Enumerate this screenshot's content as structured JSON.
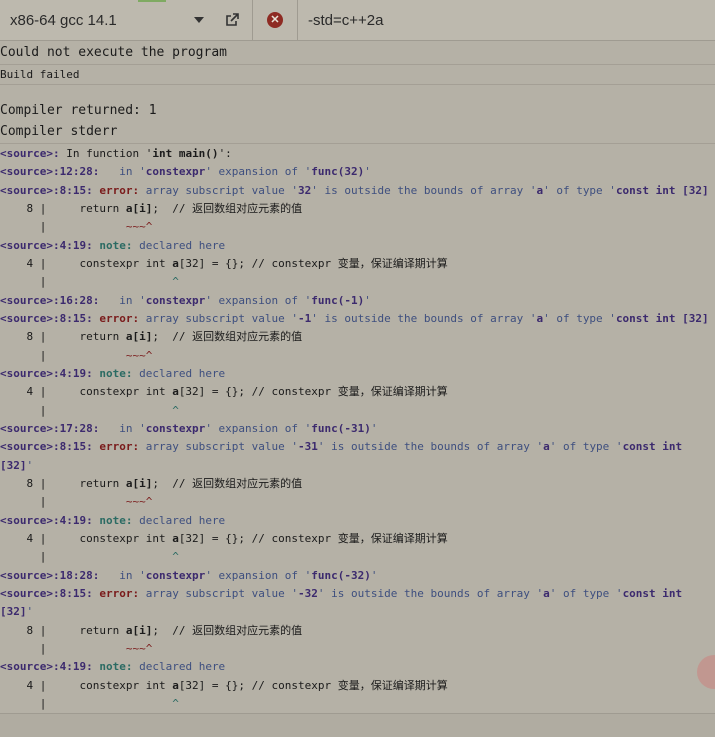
{
  "toolbar": {
    "compiler": "x86-64 gcc 14.1",
    "flags": "-std=c++2a",
    "close_glyph": "✕"
  },
  "output": {
    "status": "Could not execute the program",
    "build": "Build failed",
    "returned": "Compiler returned: 1",
    "stderr_title": "Compiler stderr"
  },
  "log": [
    [
      {
        "t": "<source>:",
        "c": "src"
      },
      {
        "t": " In function '"
      },
      {
        "t": "int main()",
        "c": "bold"
      },
      {
        "t": "':"
      }
    ],
    [
      {
        "t": "<source>:12:28:",
        "c": "src"
      },
      {
        "t": "   in '",
        "c": "blue"
      },
      {
        "t": "constexpr",
        "c": "src"
      },
      {
        "t": "' expansion of '",
        "c": "blue"
      },
      {
        "t": "func(32)",
        "c": "src"
      },
      {
        "t": "'",
        "c": "blue"
      }
    ],
    [
      {
        "t": "<source>:8:15:",
        "c": "src"
      },
      {
        "t": " error:",
        "c": "err"
      },
      {
        "t": " array subscript value '",
        "c": "blue"
      },
      {
        "t": "32",
        "c": "src"
      },
      {
        "t": "' is outside the bounds of array '",
        "c": "blue"
      },
      {
        "t": "a",
        "c": "src"
      },
      {
        "t": "' of type '",
        "c": "blue"
      },
      {
        "t": "const int [32]",
        "c": "src"
      }
    ],
    [
      {
        "t": "    8 |     return "
      },
      {
        "t": "a[i]",
        "c": "bold"
      },
      {
        "t": ";  // "
      },
      {
        "t": "返回数组对应元素的值",
        "c": "cn"
      }
    ],
    [
      {
        "t": "      |            "
      },
      {
        "t": "~~~^",
        "c": "caret-r"
      }
    ],
    [
      {
        "t": "<source>:4:19:",
        "c": "src"
      },
      {
        "t": " note:",
        "c": "note"
      },
      {
        "t": " declared here",
        "c": "blue"
      }
    ],
    [
      {
        "t": "    4 |     constexpr int "
      },
      {
        "t": "a",
        "c": "bold"
      },
      {
        "t": "[32] = {}; // constexpr "
      },
      {
        "t": "变量，保证编译期计算",
        "c": "cn"
      }
    ],
    [
      {
        "t": "      |                   "
      },
      {
        "t": "^",
        "c": "caret-g"
      }
    ],
    [
      {
        "t": "<source>:16:28:",
        "c": "src"
      },
      {
        "t": "   in '",
        "c": "blue"
      },
      {
        "t": "constexpr",
        "c": "src"
      },
      {
        "t": "' expansion of '",
        "c": "blue"
      },
      {
        "t": "func(-1)",
        "c": "src"
      },
      {
        "t": "'",
        "c": "blue"
      }
    ],
    [
      {
        "t": "<source>:8:15:",
        "c": "src"
      },
      {
        "t": " error:",
        "c": "err"
      },
      {
        "t": " array subscript value '",
        "c": "blue"
      },
      {
        "t": "-1",
        "c": "src"
      },
      {
        "t": "' is outside the bounds of array '",
        "c": "blue"
      },
      {
        "t": "a",
        "c": "src"
      },
      {
        "t": "' of type '",
        "c": "blue"
      },
      {
        "t": "const int [32]",
        "c": "src"
      }
    ],
    [
      {
        "t": "    8 |     return "
      },
      {
        "t": "a[i]",
        "c": "bold"
      },
      {
        "t": ";  // "
      },
      {
        "t": "返回数组对应元素的值",
        "c": "cn"
      }
    ],
    [
      {
        "t": "      |            "
      },
      {
        "t": "~~~^",
        "c": "caret-r"
      }
    ],
    [
      {
        "t": "<source>:4:19:",
        "c": "src"
      },
      {
        "t": " note:",
        "c": "note"
      },
      {
        "t": " declared here",
        "c": "blue"
      }
    ],
    [
      {
        "t": "    4 |     constexpr int "
      },
      {
        "t": "a",
        "c": "bold"
      },
      {
        "t": "[32] = {}; // constexpr "
      },
      {
        "t": "变量，保证编译期计算",
        "c": "cn"
      }
    ],
    [
      {
        "t": "      |                   "
      },
      {
        "t": "^",
        "c": "caret-g"
      }
    ],
    [
      {
        "t": "<source>:17:28:",
        "c": "src"
      },
      {
        "t": "   in '",
        "c": "blue"
      },
      {
        "t": "constexpr",
        "c": "src"
      },
      {
        "t": "' expansion of '",
        "c": "blue"
      },
      {
        "t": "func(-31)",
        "c": "src"
      },
      {
        "t": "'",
        "c": "blue"
      }
    ],
    [
      {
        "t": "<source>:8:15:",
        "c": "src"
      },
      {
        "t": " error:",
        "c": "err"
      },
      {
        "t": " array subscript value '",
        "c": "blue"
      },
      {
        "t": "-31",
        "c": "src"
      },
      {
        "t": "' is outside the bounds of array '",
        "c": "blue"
      },
      {
        "t": "a",
        "c": "src"
      },
      {
        "t": "' of type '",
        "c": "blue"
      },
      {
        "t": "const int",
        "c": "src"
      }
    ],
    [
      {
        "t": "[32]",
        "c": "src"
      },
      {
        "t": "'",
        "c": "blue"
      }
    ],
    [
      {
        "t": "    8 |     return "
      },
      {
        "t": "a[i]",
        "c": "bold"
      },
      {
        "t": ";  // "
      },
      {
        "t": "返回数组对应元素的值",
        "c": "cn"
      }
    ],
    [
      {
        "t": "      |            "
      },
      {
        "t": "~~~^",
        "c": "caret-r"
      }
    ],
    [
      {
        "t": "<source>:4:19:",
        "c": "src"
      },
      {
        "t": " note:",
        "c": "note"
      },
      {
        "t": " declared here",
        "c": "blue"
      }
    ],
    [
      {
        "t": "    4 |     constexpr int "
      },
      {
        "t": "a",
        "c": "bold"
      },
      {
        "t": "[32] = {}; // constexpr "
      },
      {
        "t": "变量，保证编译期计算",
        "c": "cn"
      }
    ],
    [
      {
        "t": "      |                   "
      },
      {
        "t": "^",
        "c": "caret-g"
      }
    ],
    [
      {
        "t": "<source>:18:28:",
        "c": "src"
      },
      {
        "t": "   in '",
        "c": "blue"
      },
      {
        "t": "constexpr",
        "c": "src"
      },
      {
        "t": "' expansion of '",
        "c": "blue"
      },
      {
        "t": "func(-32)",
        "c": "src"
      },
      {
        "t": "'",
        "c": "blue"
      }
    ],
    [
      {
        "t": "<source>:8:15:",
        "c": "src"
      },
      {
        "t": " error:",
        "c": "err"
      },
      {
        "t": " array subscript value '",
        "c": "blue"
      },
      {
        "t": "-32",
        "c": "src"
      },
      {
        "t": "' is outside the bounds of array '",
        "c": "blue"
      },
      {
        "t": "a",
        "c": "src"
      },
      {
        "t": "' of type '",
        "c": "blue"
      },
      {
        "t": "const int",
        "c": "src"
      }
    ],
    [
      {
        "t": "[32]",
        "c": "src"
      },
      {
        "t": "'",
        "c": "blue"
      }
    ],
    [
      {
        "t": "    8 |     return "
      },
      {
        "t": "a[i]",
        "c": "bold"
      },
      {
        "t": ";  // "
      },
      {
        "t": "返回数组对应元素的值",
        "c": "cn"
      }
    ],
    [
      {
        "t": "      |            "
      },
      {
        "t": "~~~^",
        "c": "caret-r"
      }
    ],
    [
      {
        "t": "<source>:4:19:",
        "c": "src"
      },
      {
        "t": " note:",
        "c": "note"
      },
      {
        "t": " declared here",
        "c": "blue"
      }
    ],
    [
      {
        "t": "    4 |     constexpr int "
      },
      {
        "t": "a",
        "c": "bold"
      },
      {
        "t": "[32] = {}; // constexpr "
      },
      {
        "t": "变量，保证编译期计算",
        "c": "cn"
      }
    ],
    [
      {
        "t": "      |                   "
      },
      {
        "t": "^",
        "c": "caret-g"
      }
    ]
  ]
}
